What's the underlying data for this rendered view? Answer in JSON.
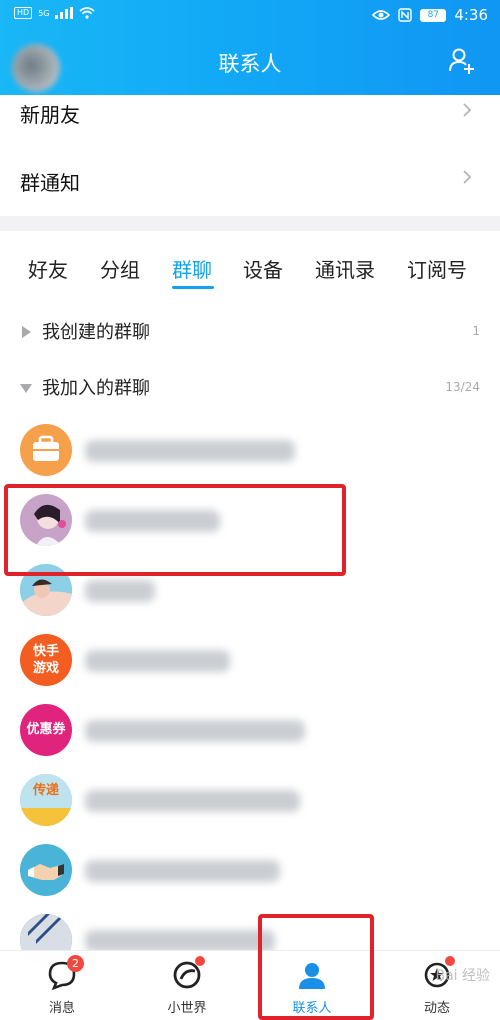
{
  "status_bar": {
    "network": "HD",
    "signal_label": "5G",
    "battery": "87",
    "time": "4:36"
  },
  "header": {
    "title": "联系人"
  },
  "rows": [
    {
      "label": "新朋友"
    },
    {
      "label": "群通知"
    }
  ],
  "tabs": [
    {
      "label": "好友"
    },
    {
      "label": "分组"
    },
    {
      "label": "群聊"
    },
    {
      "label": "设备"
    },
    {
      "label": "通讯录"
    },
    {
      "label": "订阅号"
    }
  ],
  "active_tab": "群聊",
  "sections": [
    {
      "label": "我创建的群聊",
      "count": "1",
      "expanded": false
    },
    {
      "label": "我加入的群聊",
      "count": "13/24",
      "expanded": true
    }
  ],
  "group_icons": [
    {
      "icon": "briefcase-icon",
      "color": "#f6a04b"
    },
    {
      "icon": "anime-avatar-icon",
      "color": "#e9c1d6"
    },
    {
      "icon": "photo-avatar-icon",
      "color": "#7fc7e6"
    },
    {
      "icon": "kuaishou-game-icon",
      "color": "#f35d22",
      "text": "快手\n游戏"
    },
    {
      "icon": "coupon-icon",
      "color": "#e0247d",
      "text": "优惠券"
    },
    {
      "icon": "relay-icon",
      "color": "#7ac8e0",
      "text": "传递"
    },
    {
      "icon": "handshake-icon",
      "color": "#4ab4d8"
    },
    {
      "icon": "photo-avatar-icon",
      "color": "#3a6ea8"
    }
  ],
  "bottom_nav": [
    {
      "label": "消息",
      "badge": "2"
    },
    {
      "label": "小世界"
    },
    {
      "label": "联系人"
    },
    {
      "label": "动态"
    }
  ],
  "watermark": "Bai 经验",
  "colors": {
    "accent": "#12a3ee",
    "highlight": "#e0232a",
    "badge": "#f2483e"
  }
}
